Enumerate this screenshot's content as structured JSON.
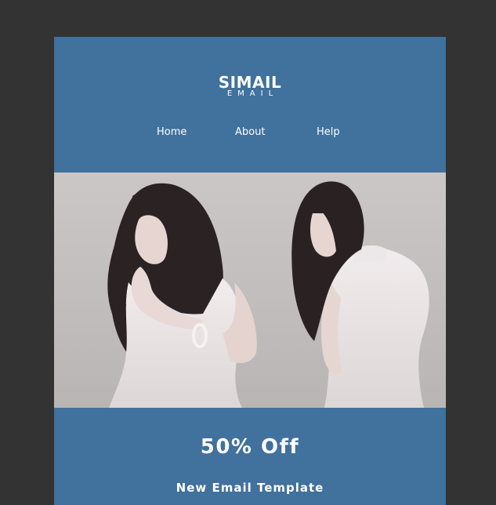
{
  "brand": {
    "title": "SIMAIL",
    "subtitle": "EMAIL"
  },
  "nav": {
    "items": [
      {
        "label": "Home"
      },
      {
        "label": "About"
      },
      {
        "label": "Help"
      }
    ]
  },
  "hero": {
    "image_subject": "two-women-white-dress-photo"
  },
  "promo": {
    "headline": "50% Off",
    "subheadline": "New Email Template"
  },
  "colors": {
    "page_background": "#333333",
    "brand_blue": "#41719d",
    "text": "#ffffff"
  }
}
